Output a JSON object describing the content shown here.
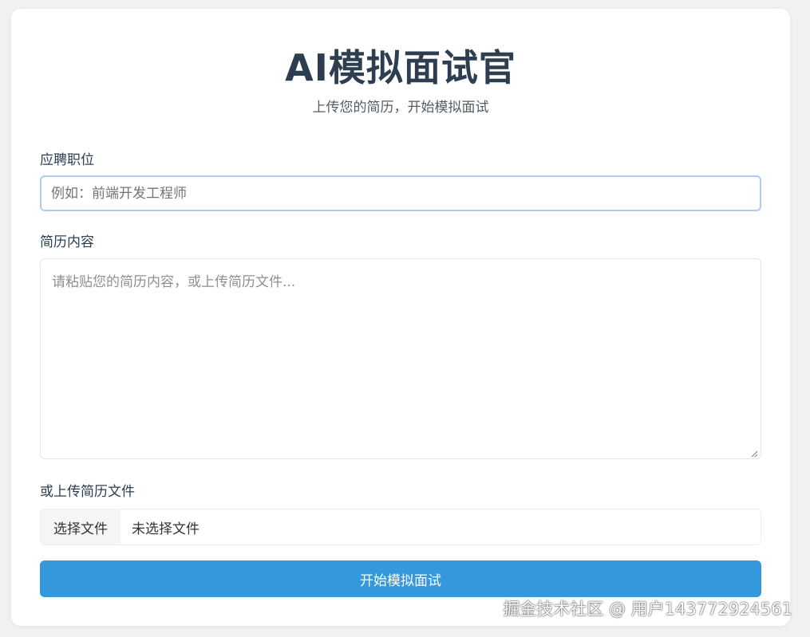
{
  "header": {
    "title": "AI模拟面试官",
    "subtitle": "上传您的简历，开始模拟面试"
  },
  "form": {
    "position": {
      "label": "应聘职位",
      "placeholder": "例如：前端开发工程师",
      "value": ""
    },
    "resume": {
      "label": "简历内容",
      "placeholder": "请粘贴您的简历内容，或上传简历文件...",
      "value": ""
    },
    "upload": {
      "label": "或上传简历文件",
      "choose_button": "选择文件",
      "status": "未选择文件"
    },
    "submit_label": "开始模拟面试"
  },
  "watermark": "掘金技术社区 @ 用户1437729245​61",
  "colors": {
    "accent": "#3498db",
    "title": "#2c3e50",
    "input_focus_border": "#aecbf0"
  }
}
